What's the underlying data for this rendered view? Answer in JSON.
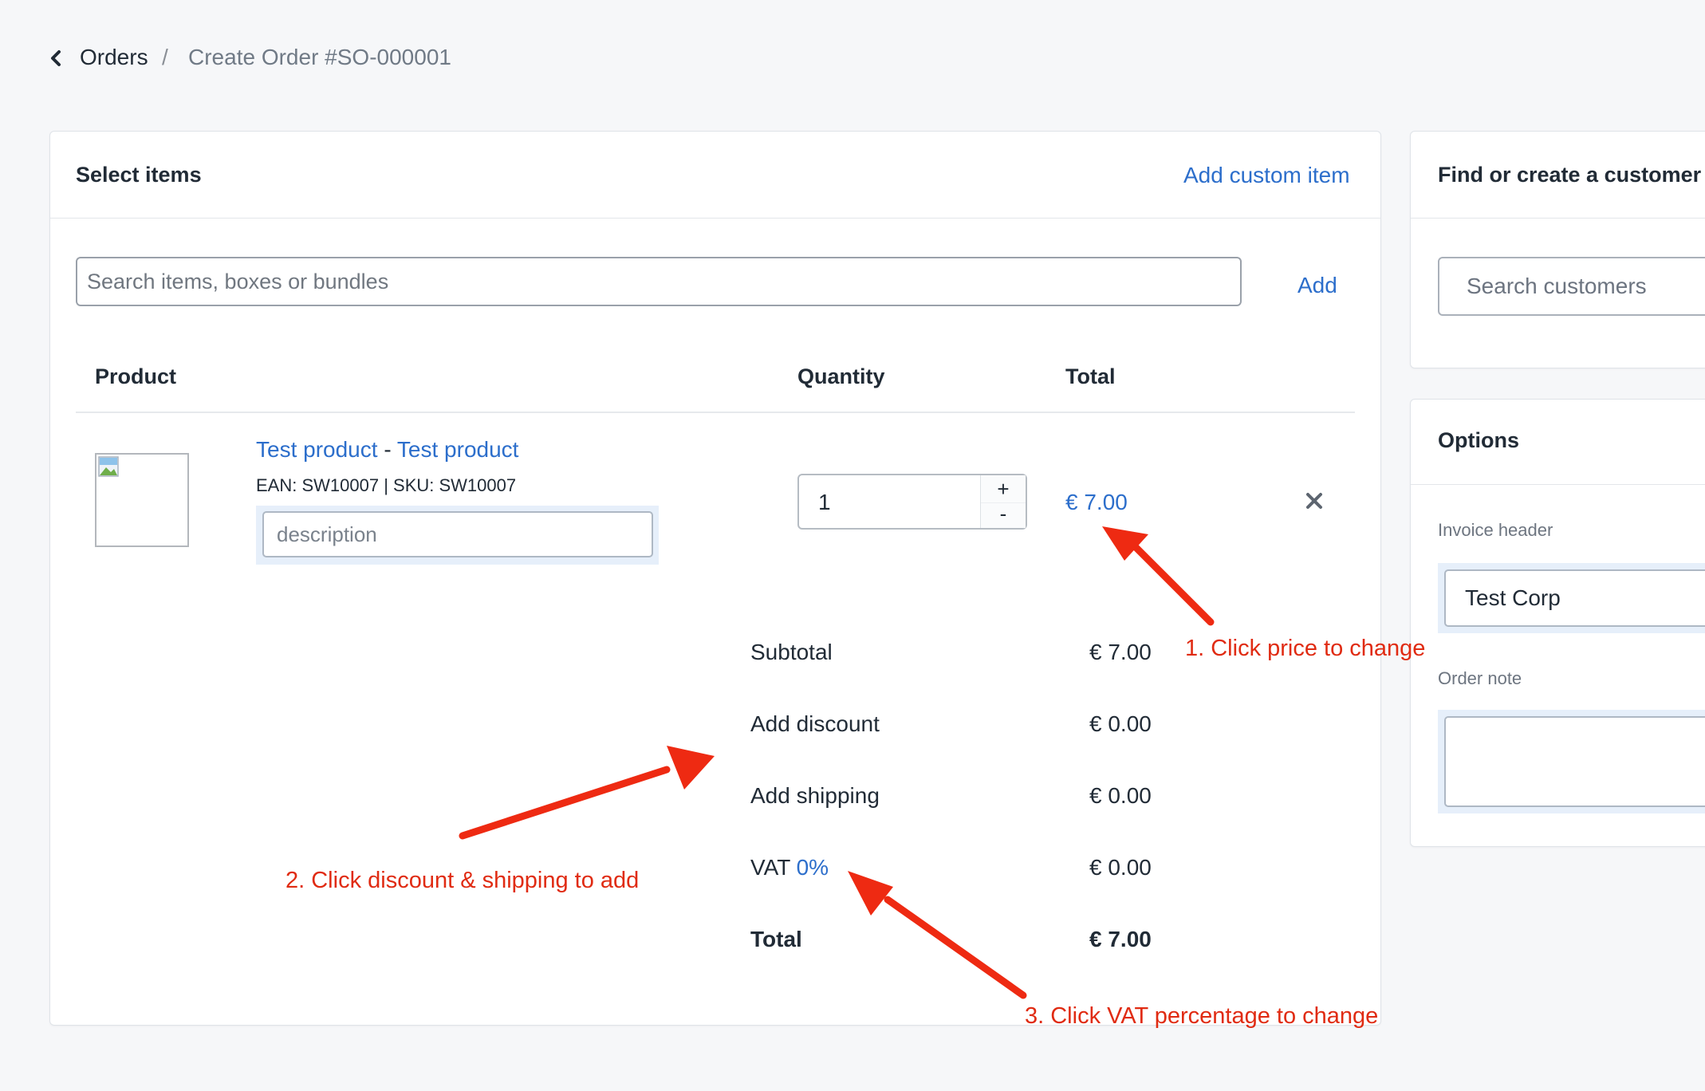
{
  "breadcrumb": {
    "back_icon": "chevron-left-icon",
    "parent": "Orders",
    "separator": "/",
    "current": "Create Order #SO-000001"
  },
  "select_items": {
    "title": "Select items",
    "add_custom_item": "Add custom item",
    "search_placeholder": "Search items, boxes or bundles",
    "add_label": "Add",
    "columns": [
      "Product",
      "Quantity",
      "Total"
    ],
    "items": [
      {
        "product_name": "Test product",
        "variant_name": "Test product",
        "name_separator": "-",
        "meta": "EAN: SW10007 | SKU: SW10007",
        "description_placeholder": "description",
        "quantity": "1",
        "total": "€ 7.00"
      }
    ],
    "qty_plus": "+",
    "qty_minus": "-",
    "remove_icon": "close-x-icon"
  },
  "summary": {
    "subtotal_label": "Subtotal",
    "subtotal_value": "€ 7.00",
    "discount_label": "Add discount",
    "discount_value": "€ 0.00",
    "shipping_label": "Add shipping",
    "shipping_value": "€ 0.00",
    "vat_label": "VAT",
    "vat_percent": "0%",
    "vat_value": "€ 0.00",
    "total_label": "Total",
    "total_value": "€ 7.00"
  },
  "customer": {
    "title": "Find or create a customer",
    "search_placeholder": "Search customers"
  },
  "options": {
    "title": "Options",
    "invoice_header_label": "Invoice header",
    "invoice_header_value": "Test Corp",
    "order_note_label": "Order note",
    "order_note_value": ""
  },
  "annotations": {
    "note1": "1. Click price to change",
    "note2": "2. Click discount & shipping to add",
    "note3": "3. Click VAT percentage to change",
    "color": "#e02b12"
  },
  "colors": {
    "link": "#2c6ecb",
    "background": "#f6f7f9",
    "text": "#212b36"
  }
}
